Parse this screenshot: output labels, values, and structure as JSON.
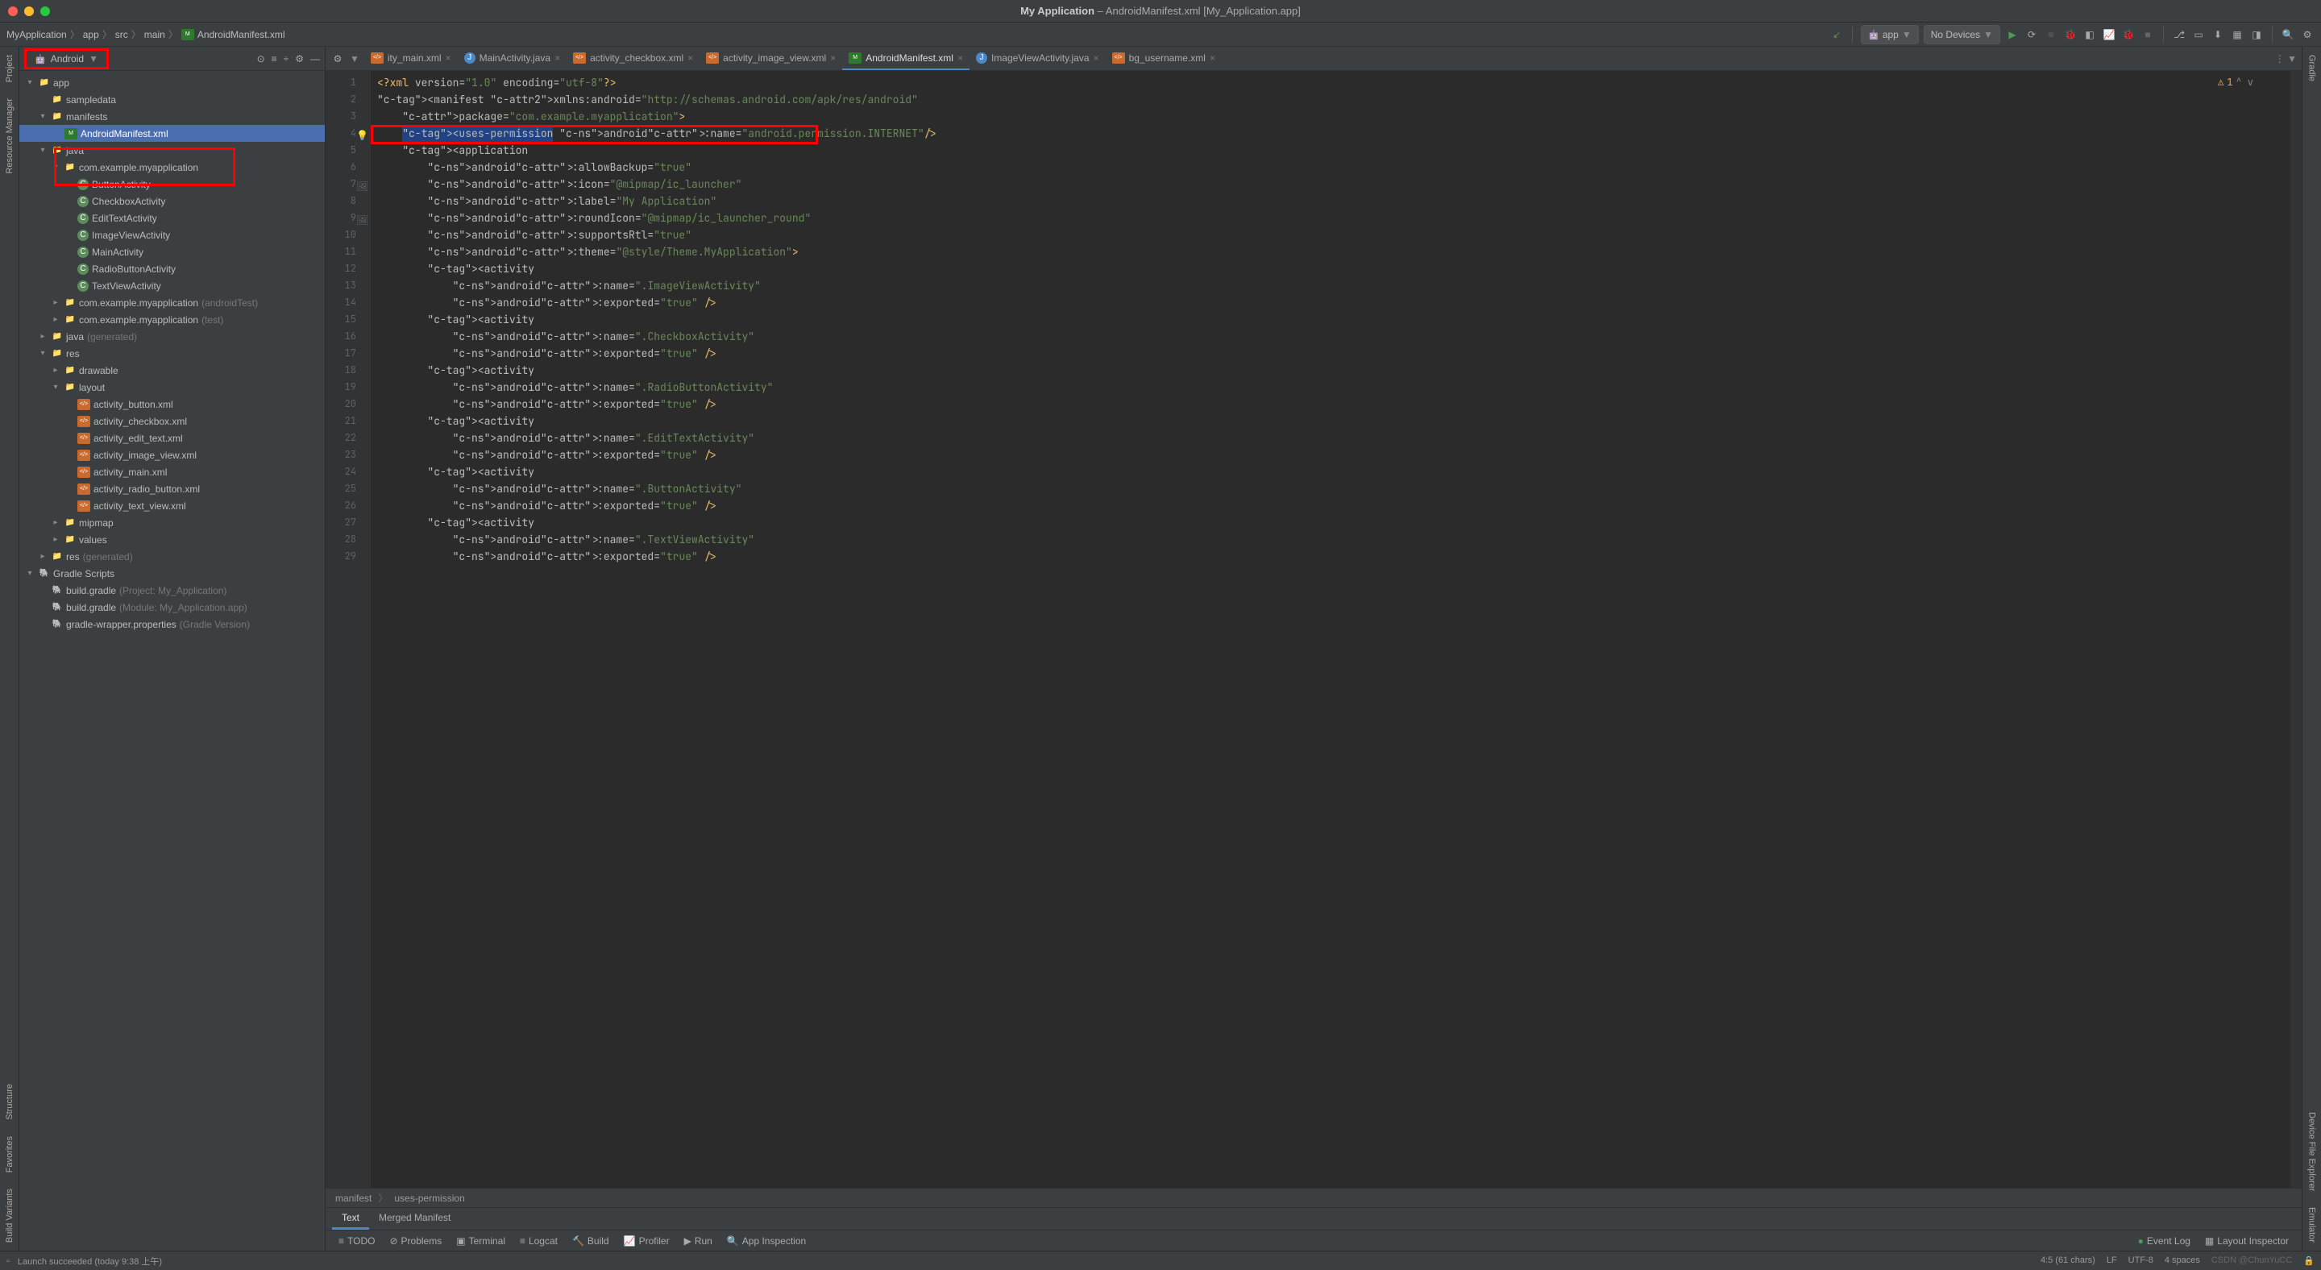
{
  "title": {
    "app": "My Application",
    "file": "AndroidManifest.xml",
    "module": "My_Application.app"
  },
  "breadcrumbs": [
    "MyApplication",
    "app",
    "src",
    "main",
    "AndroidManifest.xml"
  ],
  "run_config": "app",
  "devices": "No Devices",
  "project_view": "Android",
  "tree": {
    "root": "app",
    "sampledata": "sampledata",
    "manifests": "manifests",
    "manifest_file": "AndroidManifest.xml",
    "java": "java",
    "pkg": "com.example.myapplication",
    "classes": [
      "ButtonActivity",
      "CheckboxActivity",
      "EditTextActivity",
      "ImageViewActivity",
      "MainActivity",
      "RadioButtonActivity",
      "TextViewActivity"
    ],
    "pkg_at": "com.example.myapplication",
    "pkg_at_suffix": "(androidTest)",
    "pkg_t": "com.example.myapplication",
    "pkg_t_suffix": "(test)",
    "java_gen": "java",
    "java_gen_suffix": "(generated)",
    "res": "res",
    "drawable": "drawable",
    "layout": "layout",
    "layouts": [
      "activity_button.xml",
      "activity_checkbox.xml",
      "activity_edit_text.xml",
      "activity_image_view.xml",
      "activity_main.xml",
      "activity_radio_button.xml",
      "activity_text_view.xml"
    ],
    "mipmap": "mipmap",
    "values": "values",
    "res_gen": "res",
    "res_gen_suffix": "(generated)",
    "gradle_scripts": "Gradle Scripts",
    "gradle_items": [
      {
        "name": "build.gradle",
        "suffix": "(Project: My_Application)"
      },
      {
        "name": "build.gradle",
        "suffix": "(Module: My_Application.app)"
      },
      {
        "name": "gradle-wrapper.properties",
        "suffix": "(Gradle Version)"
      }
    ]
  },
  "tabs": [
    {
      "name": "ity_main.xml",
      "type": "xml"
    },
    {
      "name": "MainActivity.java",
      "type": "java"
    },
    {
      "name": "activity_checkbox.xml",
      "type": "xml"
    },
    {
      "name": "activity_image_view.xml",
      "type": "xml"
    },
    {
      "name": "AndroidManifest.xml",
      "type": "mf",
      "active": true
    },
    {
      "name": "ImageViewActivity.java",
      "type": "java"
    },
    {
      "name": "bg_username.xml",
      "type": "xml"
    }
  ],
  "warnings": "1",
  "code": [
    {
      "n": 1,
      "txt": "<?xml version=\"1.0\" encoding=\"utf-8\"?>",
      "kind": "pi"
    },
    {
      "n": 2,
      "txt": "<manifest xmlns:android=\"http://schemas.android.com/apk/res/android\""
    },
    {
      "n": 3,
      "txt": "    package=\"com.example.myapplication\">"
    },
    {
      "n": 4,
      "txt": "    <uses-permission android:name=\"android.permission.INTERNET\"/>",
      "hl": true
    },
    {
      "n": 5,
      "txt": "    <application"
    },
    {
      "n": 6,
      "txt": "        android:allowBackup=\"true\""
    },
    {
      "n": 7,
      "txt": "        android:icon=\"@mipmap/ic_launcher\"",
      "gutter": "img"
    },
    {
      "n": 8,
      "txt": "        android:label=\"My Application\""
    },
    {
      "n": 9,
      "txt": "        android:roundIcon=\"@mipmap/ic_launcher_round\"",
      "gutter": "img"
    },
    {
      "n": 10,
      "txt": "        android:supportsRtl=\"true\""
    },
    {
      "n": 11,
      "txt": "        android:theme=\"@style/Theme.MyApplication\">"
    },
    {
      "n": 12,
      "txt": "        <activity"
    },
    {
      "n": 13,
      "txt": "            android:name=\".ImageViewActivity\""
    },
    {
      "n": 14,
      "txt": "            android:exported=\"true\" />"
    },
    {
      "n": 15,
      "txt": "        <activity"
    },
    {
      "n": 16,
      "txt": "            android:name=\".CheckboxActivity\""
    },
    {
      "n": 17,
      "txt": "            android:exported=\"true\" />"
    },
    {
      "n": 18,
      "txt": "        <activity"
    },
    {
      "n": 19,
      "txt": "            android:name=\".RadioButtonActivity\""
    },
    {
      "n": 20,
      "txt": "            android:exported=\"true\" />"
    },
    {
      "n": 21,
      "txt": "        <activity"
    },
    {
      "n": 22,
      "txt": "            android:name=\".EditTextActivity\""
    },
    {
      "n": 23,
      "txt": "            android:exported=\"true\" />"
    },
    {
      "n": 24,
      "txt": "        <activity"
    },
    {
      "n": 25,
      "txt": "            android:name=\".ButtonActivity\""
    },
    {
      "n": 26,
      "txt": "            android:exported=\"true\" />"
    },
    {
      "n": 27,
      "txt": "        <activity"
    },
    {
      "n": 28,
      "txt": "            android:name=\".TextViewActivity\""
    },
    {
      "n": 29,
      "txt": "            android:exported=\"true\" />"
    }
  ],
  "ed_crumbs": [
    "manifest",
    "uses-permission"
  ],
  "bottom_tabs": {
    "text": "Text",
    "merged": "Merged Manifest"
  },
  "tool_windows": [
    "TODO",
    "Problems",
    "Terminal",
    "Logcat",
    "Build",
    "Profiler",
    "Run",
    "App Inspection"
  ],
  "tw_right": [
    "Event Log",
    "Layout Inspector"
  ],
  "status": {
    "msg": "Launch succeeded (today 9:38 上午)",
    "pos": "4:5 (61 chars)",
    "le": "LF",
    "enc": "UTF-8",
    "sp": "4 spaces",
    "watermark": "CSDN @ChunYuCC"
  },
  "left_tabs": [
    "Project",
    "Resource Manager",
    "Structure",
    "Favorites",
    "Build Variants"
  ],
  "right_tabs": [
    "Gradle",
    "Device File Explorer",
    "Emulator"
  ]
}
